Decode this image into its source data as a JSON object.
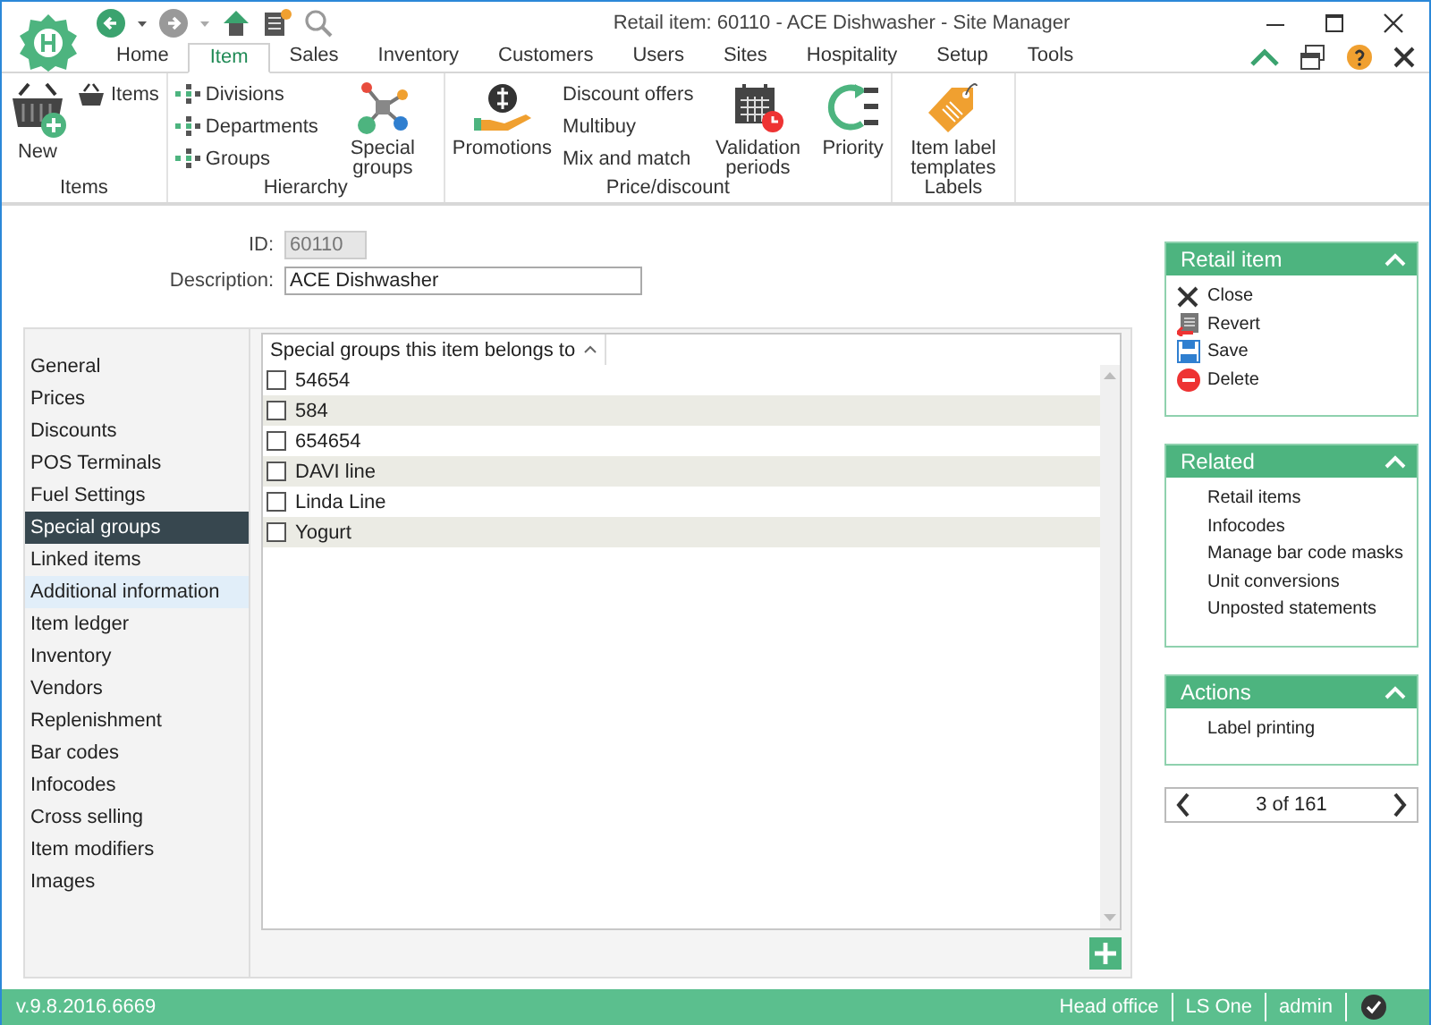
{
  "window": {
    "title": "Retail item: 60110 - ACE Dishwasher - Site Manager"
  },
  "ribbon_tabs": [
    {
      "label": "Home",
      "selected": false
    },
    {
      "label": "Item",
      "selected": true
    },
    {
      "label": "Sales",
      "selected": false
    },
    {
      "label": "Inventory",
      "selected": false
    },
    {
      "label": "Customers",
      "selected": false
    },
    {
      "label": "Users",
      "selected": false
    },
    {
      "label": "Sites",
      "selected": false
    },
    {
      "label": "Hospitality",
      "selected": false
    },
    {
      "label": "Setup",
      "selected": false
    },
    {
      "label": "Tools",
      "selected": false
    }
  ],
  "ribbon_groups": [
    {
      "label": "Items",
      "buttons": [
        {
          "label": "New",
          "kind": "large"
        },
        {
          "label": "Items",
          "kind": "small"
        }
      ]
    },
    {
      "label": "Hierarchy",
      "buttons": [
        {
          "label": "Divisions",
          "kind": "small"
        },
        {
          "label": "Departments",
          "kind": "small"
        },
        {
          "label": "Groups",
          "kind": "small"
        },
        {
          "label": "Special groups",
          "kind": "large"
        }
      ]
    },
    {
      "label": "Price/discount",
      "buttons": [
        {
          "label": "Promotions",
          "kind": "large"
        },
        {
          "label": "Discount offers",
          "kind": "small"
        },
        {
          "label": "Multibuy",
          "kind": "small"
        },
        {
          "label": "Mix and match",
          "kind": "small"
        },
        {
          "label": "Validation periods",
          "kind": "large"
        },
        {
          "label": "Priority",
          "kind": "large"
        }
      ]
    },
    {
      "label": "Labels",
      "buttons": [
        {
          "label": "Item label templates",
          "kind": "large"
        }
      ]
    }
  ],
  "form": {
    "id_label": "ID:",
    "id_value": "60110",
    "description_label": "Description:",
    "description_value": "ACE Dishwasher"
  },
  "nav": [
    {
      "label": "General",
      "selected": false,
      "hovered": false
    },
    {
      "label": "Prices",
      "selected": false,
      "hovered": false
    },
    {
      "label": "Discounts",
      "selected": false,
      "hovered": false
    },
    {
      "label": "POS Terminals",
      "selected": false,
      "hovered": false
    },
    {
      "label": "Fuel Settings",
      "selected": false,
      "hovered": false
    },
    {
      "label": "Special groups",
      "selected": true,
      "hovered": false
    },
    {
      "label": "Linked items",
      "selected": false,
      "hovered": false
    },
    {
      "label": "Additional information",
      "selected": false,
      "hovered": true
    },
    {
      "label": "Item ledger",
      "selected": false,
      "hovered": false
    },
    {
      "label": "Inventory",
      "selected": false,
      "hovered": false
    },
    {
      "label": "Vendors",
      "selected": false,
      "hovered": false
    },
    {
      "label": "Replenishment",
      "selected": false,
      "hovered": false
    },
    {
      "label": "Bar codes",
      "selected": false,
      "hovered": false
    },
    {
      "label": "Infocodes",
      "selected": false,
      "hovered": false
    },
    {
      "label": "Cross selling",
      "selected": false,
      "hovered": false
    },
    {
      "label": "Item modifiers",
      "selected": false,
      "hovered": false
    },
    {
      "label": "Images",
      "selected": false,
      "hovered": false
    }
  ],
  "table": {
    "columns": [
      {
        "label": "Special groups this item belongs to"
      }
    ],
    "rows": [
      {
        "label": "54654",
        "checked": false
      },
      {
        "label": "584",
        "checked": false
      },
      {
        "label": "654654",
        "checked": false
      },
      {
        "label": "DAVI line",
        "checked": false
      },
      {
        "label": "Linda Line",
        "checked": false
      },
      {
        "label": "Yogurt",
        "checked": false
      }
    ]
  },
  "side_panels": [
    {
      "title": "Retail item",
      "expanded": true,
      "items": [
        {
          "label": "Close"
        },
        {
          "label": "Revert"
        },
        {
          "label": "Save"
        },
        {
          "label": "Delete"
        }
      ]
    },
    {
      "title": "Related",
      "expanded": true,
      "items": [
        {
          "label": "Retail items"
        },
        {
          "label": "Infocodes"
        },
        {
          "label": "Manage bar code masks"
        },
        {
          "label": "Unit conversions"
        },
        {
          "label": "Unposted statements"
        }
      ]
    },
    {
      "title": "Actions",
      "expanded": true,
      "items": [
        {
          "label": "Label printing"
        }
      ]
    }
  ],
  "pager": {
    "text": "3 of 161"
  },
  "status_bar": {
    "version": "v.9.8.2016.6669",
    "fields": [
      "Head office",
      "LS One",
      "admin"
    ]
  }
}
